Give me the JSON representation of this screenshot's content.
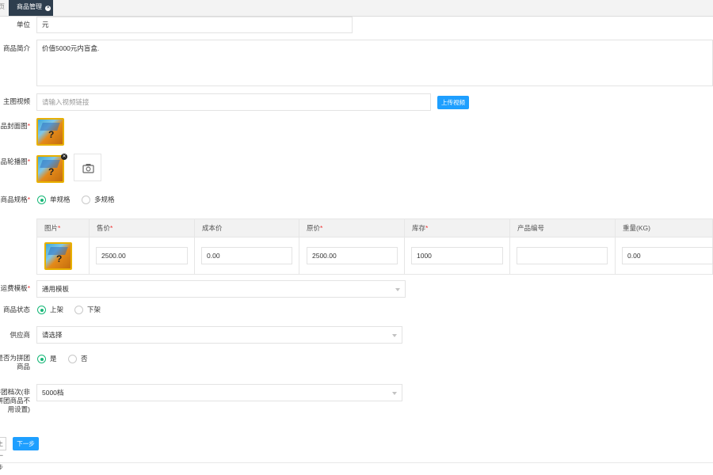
{
  "tabs": {
    "prev_label": "页",
    "active_label": "商品管理",
    "close_glyph": "✕"
  },
  "form": {
    "unit": {
      "label": "单位",
      "value": "元"
    },
    "intro": {
      "label": "商品简介",
      "value": "价值5000元内盲盒."
    },
    "video": {
      "label": "主图视频",
      "placeholder": "请输入视频链接",
      "button": "上传视频"
    },
    "cover": {
      "label": "商品封面图",
      "required_mark": "*"
    },
    "carousel": {
      "label": "商品轮播图",
      "required_mark": "*",
      "delete_glyph": "✕",
      "upload_icon": "camera-icon"
    },
    "spec": {
      "label": "商品规格",
      "required_mark": "*",
      "options": [
        {
          "label": "单规格",
          "selected": true
        },
        {
          "label": "多规格",
          "selected": false
        }
      ]
    },
    "sku_table": {
      "headers": [
        {
          "label": "图片",
          "required": true
        },
        {
          "label": "售价",
          "required": true
        },
        {
          "label": "成本价",
          "required": false
        },
        {
          "label": "原价",
          "required": true
        },
        {
          "label": "库存",
          "required": true
        },
        {
          "label": "产品编号",
          "required": false
        },
        {
          "label": "重量(KG)",
          "required": false
        }
      ],
      "row": {
        "price": "2500.00",
        "cost": "0.00",
        "original": "2500.00",
        "stock": "1000",
        "code": "",
        "weight": "0.00"
      }
    },
    "shipping": {
      "label": "运费模板",
      "required_mark": "*",
      "value": "通用模板"
    },
    "status": {
      "label": "商品状态",
      "options": [
        {
          "label": "上架",
          "selected": true
        },
        {
          "label": "下架",
          "selected": false
        }
      ]
    },
    "supplier": {
      "label": "供应商",
      "value": "请选择"
    },
    "group": {
      "label_line1": "是否为拼团",
      "label_line2": "商品",
      "options": [
        {
          "label": "是",
          "selected": true
        },
        {
          "label": "否",
          "selected": false
        }
      ]
    },
    "group_level": {
      "label_line1": "拼团档次(非",
      "label_line2": "拼团商品不",
      "label_line3": "用设置)",
      "value": "5000档"
    }
  },
  "footer": {
    "prev_label": "上一步",
    "next_label": "下一步"
  },
  "colors": {
    "primary": "#1e9fff",
    "radio": "#16b777",
    "tab_bg": "#2e3e4e",
    "required": "#e33333"
  }
}
